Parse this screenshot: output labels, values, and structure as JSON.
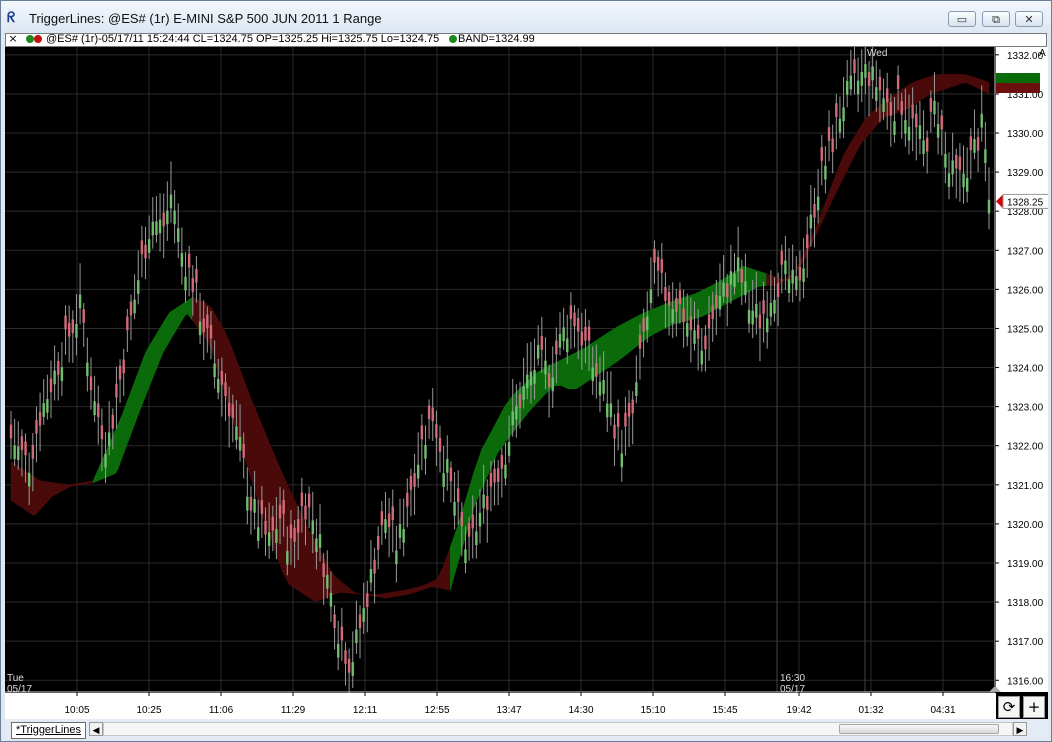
{
  "window": {
    "title": "TriggerLines: @ES# (1r) E-MINI S&P 500 JUN 2011 1 Range",
    "minimize": "▭",
    "maximize": "⧉",
    "close": "✕"
  },
  "infobar": {
    "close": "×",
    "text": "@ES# (1r)-05/17/11 15:24:44 CL=1324.75 OP=1325.25 Hi=1325.75 Lo=1324.75",
    "band_text": "BAND=1324.99",
    "colors": {
      "dot1": "#1e8a1e",
      "dot2": "#c31010",
      "dot3": "#1e8a1e"
    }
  },
  "bottom": {
    "tab_label": "*TriggerLines",
    "scroll_left": "◀",
    "scroll_right": "▶",
    "refresh_icon": "⟳",
    "add_icon": "+"
  },
  "chart_data": {
    "type": "candlestick",
    "instrument": "@ES# (1r) E-MINI S&P 500 JUN 2011 1 Range",
    "ylim": [
      1315.7,
      1332.2
    ],
    "y_ticks": [
      1316,
      1317,
      1318,
      1319,
      1320,
      1321,
      1322,
      1323,
      1324,
      1325,
      1326,
      1327,
      1328,
      1329,
      1330,
      1331,
      1332
    ],
    "y_tick_labels": [
      "1316.00",
      "1317.00",
      "1318.00",
      "1319.00",
      "1320.00",
      "1321.00",
      "1322.00",
      "1323.00",
      "1324.00",
      "1325.00",
      "1326.00",
      "1327.00",
      "1328.00",
      "1329.00",
      "1330.00",
      "1331.00",
      "1332.00"
    ],
    "x_tick_labels": [
      "10:05",
      "10:25",
      "11:06",
      "11:29",
      "12:11",
      "12:55",
      "13:47",
      "14:30",
      "15:10",
      "15:45",
      "19:42",
      "01:32",
      "04:31"
    ],
    "day_labels": [
      {
        "day": "Tue",
        "date": "05/17"
      },
      {
        "time": "16:30",
        "date": "05/17"
      },
      {
        "day": "Wed"
      }
    ],
    "last_price_label": "1328.25",
    "band_labels": [
      "1331.50",
      "1331.00"
    ],
    "corner_label": "A",
    "bar_count": 270,
    "price_path": [
      [
        0,
        1322.2
      ],
      [
        6,
        1321.5
      ],
      [
        10,
        1322.8
      ],
      [
        18,
        1324.5
      ],
      [
        24,
        1325.6
      ],
      [
        28,
        1323.2
      ],
      [
        33,
        1322.0
      ],
      [
        38,
        1324.0
      ],
      [
        44,
        1326.5
      ],
      [
        48,
        1327.8
      ],
      [
        52,
        1327.6
      ],
      [
        55,
        1328.5
      ],
      [
        58,
        1327.0
      ],
      [
        62,
        1326.2
      ],
      [
        66,
        1325.0
      ],
      [
        70,
        1324.0
      ],
      [
        74,
        1323.2
      ],
      [
        78,
        1322.0
      ],
      [
        82,
        1320.5
      ],
      [
        88,
        1319.5
      ],
      [
        92,
        1320.2
      ],
      [
        96,
        1319.3
      ],
      [
        100,
        1320.6
      ],
      [
        104,
        1320.0
      ],
      [
        108,
        1318.6
      ],
      [
        112,
        1317.2
      ],
      [
        116,
        1316.4
      ],
      [
        120,
        1317.6
      ],
      [
        124,
        1319.0
      ],
      [
        128,
        1320.2
      ],
      [
        132,
        1319.4
      ],
      [
        136,
        1320.8
      ],
      [
        140,
        1322.0
      ],
      [
        144,
        1322.8
      ],
      [
        148,
        1321.6
      ],
      [
        152,
        1320.4
      ],
      [
        156,
        1319.2
      ],
      [
        160,
        1320.2
      ],
      [
        164,
        1321.0
      ],
      [
        168,
        1321.6
      ],
      [
        172,
        1322.8
      ],
      [
        176,
        1323.6
      ],
      [
        180,
        1324.2
      ],
      [
        184,
        1323.8
      ],
      [
        188,
        1324.8
      ],
      [
        192,
        1325.3
      ],
      [
        196,
        1324.6
      ],
      [
        200,
        1323.8
      ],
      [
        204,
        1323.2
      ],
      [
        208,
        1322.0
      ],
      [
        212,
        1322.6
      ],
      [
        216,
        1324.8
      ],
      [
        220,
        1326.4
      ],
      [
        224,
        1325.8
      ],
      [
        228,
        1325.6
      ],
      [
        232,
        1325.0
      ],
      [
        236,
        1324.4
      ],
      [
        240,
        1325.4
      ],
      [
        244,
        1326.0
      ],
      [
        248,
        1326.6
      ],
      [
        252,
        1325.6
      ],
      [
        256,
        1325.2
      ],
      [
        260,
        1326.0
      ],
      [
        264,
        1326.4
      ],
      [
        268,
        1326.0
      ],
      [
        272,
        1327.2
      ],
      [
        276,
        1328.8
      ],
      [
        280,
        1329.6
      ],
      [
        284,
        1330.8
      ],
      [
        288,
        1331.2
      ],
      [
        292,
        1331.6
      ],
      [
        296,
        1331.2
      ],
      [
        300,
        1330.6
      ],
      [
        304,
        1330.8
      ],
      [
        308,
        1330.2
      ],
      [
        312,
        1329.6
      ],
      [
        316,
        1330.8
      ],
      [
        320,
        1329.0
      ],
      [
        324,
        1328.8
      ],
      [
        328,
        1329.4
      ],
      [
        332,
        1330.2
      ],
      [
        334,
        1328.25
      ]
    ],
    "band": {
      "name": "BAND",
      "last_value": 1324.99,
      "bullish_color": "#0b6b0b",
      "bearish_color": "#4a0a0a",
      "upper": [
        [
          0,
          1321.6
        ],
        [
          10,
          1321.1
        ],
        [
          20,
          1321.0
        ],
        [
          28,
          1321.1
        ],
        [
          38,
          1322.8
        ],
        [
          46,
          1324.4
        ],
        [
          54,
          1325.4
        ],
        [
          62,
          1325.8
        ],
        [
          68,
          1325.6
        ],
        [
          74,
          1324.8
        ],
        [
          82,
          1323.2
        ],
        [
          92,
          1321.4
        ],
        [
          102,
          1319.8
        ],
        [
          110,
          1318.7
        ],
        [
          118,
          1318.2
        ],
        [
          126,
          1318.2
        ],
        [
          134,
          1318.3
        ],
        [
          140,
          1318.4
        ],
        [
          146,
          1318.6
        ],
        [
          152,
          1319.8
        ],
        [
          160,
          1321.8
        ],
        [
          170,
          1323.2
        ],
        [
          180,
          1323.9
        ],
        [
          188,
          1324.2
        ],
        [
          196,
          1324.5
        ],
        [
          206,
          1325.0
        ],
        [
          216,
          1325.4
        ],
        [
          226,
          1325.7
        ],
        [
          234,
          1325.9
        ],
        [
          242,
          1326.2
        ],
        [
          250,
          1326.6
        ],
        [
          258,
          1326.4
        ],
        [
          266,
          1326.2
        ],
        [
          274,
          1327.4
        ],
        [
          284,
          1329.4
        ],
        [
          292,
          1330.4
        ],
        [
          300,
          1330.9
        ],
        [
          308,
          1331.3
        ],
        [
          316,
          1331.5
        ],
        [
          326,
          1331.5
        ],
        [
          334,
          1331.3
        ]
      ],
      "lower": [
        [
          0,
          1320.6
        ],
        [
          8,
          1320.2
        ],
        [
          14,
          1320.7
        ],
        [
          20,
          1320.95
        ],
        [
          28,
          1321.05
        ],
        [
          36,
          1321.3
        ],
        [
          44,
          1322.9
        ],
        [
          52,
          1324.4
        ],
        [
          60,
          1325.4
        ],
        [
          68,
          1324.6
        ],
        [
          76,
          1322.6
        ],
        [
          86,
          1320.2
        ],
        [
          94,
          1318.5
        ],
        [
          104,
          1318.0
        ],
        [
          112,
          1318.25
        ],
        [
          120,
          1318.2
        ],
        [
          128,
          1318.1
        ],
        [
          136,
          1318.2
        ],
        [
          144,
          1318.4
        ],
        [
          150,
          1318.3
        ],
        [
          158,
          1320.4
        ],
        [
          166,
          1321.8
        ],
        [
          176,
          1322.8
        ],
        [
          186,
          1323.6
        ],
        [
          192,
          1323.4
        ],
        [
          198,
          1323.7
        ],
        [
          208,
          1324.2
        ],
        [
          218,
          1324.8
        ],
        [
          226,
          1325.1
        ],
        [
          236,
          1325.3
        ],
        [
          246,
          1325.7
        ],
        [
          256,
          1326.1
        ],
        [
          262,
          1326.1
        ],
        [
          270,
          1326.6
        ],
        [
          280,
          1328.2
        ],
        [
          290,
          1329.7
        ],
        [
          298,
          1330.4
        ],
        [
          306,
          1330.6
        ],
        [
          314,
          1331.0
        ],
        [
          326,
          1331.3
        ],
        [
          334,
          1331.0
        ]
      ],
      "crossovers": [
        28,
        62,
        150,
        258
      ]
    },
    "grid": true,
    "legend": "none"
  }
}
